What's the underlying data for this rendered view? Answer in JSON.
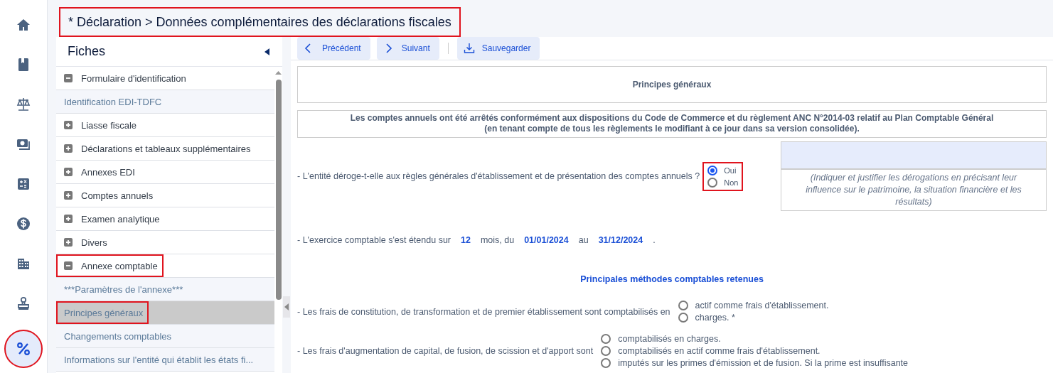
{
  "header": {
    "title": "* Déclaration > Données complémentaires des déclarations fiscales",
    "highlighted": true
  },
  "nav": [
    {
      "kind": "home",
      "selected": false,
      "highlighted": false
    },
    {
      "kind": "book",
      "selected": false,
      "highlighted": false
    },
    {
      "kind": "scale",
      "selected": false,
      "highlighted": false
    },
    {
      "kind": "money",
      "selected": false,
      "highlighted": false
    },
    {
      "kind": "calculator",
      "selected": false,
      "highlighted": false
    },
    {
      "kind": "dollar",
      "selected": false,
      "highlighted": false
    },
    {
      "kind": "building",
      "selected": false,
      "highlighted": false
    },
    {
      "kind": "stamp",
      "selected": false,
      "highlighted": false
    },
    {
      "kind": "percent",
      "selected": true,
      "highlighted": true
    }
  ],
  "sidebar": {
    "title": "Fiches",
    "items": [
      {
        "label": "Formulaire d'identification",
        "expanded": true,
        "highlighted": false,
        "children": [
          {
            "label": "Identification EDI-TDFC",
            "selected": false,
            "highlighted": false
          }
        ]
      },
      {
        "label": "Liasse fiscale",
        "expanded": false,
        "highlighted": false
      },
      {
        "label": "Déclarations et tableaux supplémentaires",
        "expanded": false,
        "highlighted": false
      },
      {
        "label": "Annexes EDI",
        "expanded": false,
        "highlighted": false
      },
      {
        "label": "Comptes annuels",
        "expanded": false,
        "highlighted": false
      },
      {
        "label": "Examen analytique",
        "expanded": false,
        "highlighted": false
      },
      {
        "label": "Divers",
        "expanded": false,
        "highlighted": false
      },
      {
        "label": "Annexe comptable",
        "expanded": true,
        "highlighted": true,
        "children": [
          {
            "label": "***Paramètres de l'annexe***",
            "selected": false,
            "highlighted": false
          },
          {
            "label": "Principes généraux",
            "selected": true,
            "highlighted": true
          },
          {
            "label": "Changements comptables",
            "selected": false,
            "highlighted": false
          },
          {
            "label": "Informations sur l'entité qui établit les états fi...",
            "selected": false,
            "highlighted": false
          }
        ]
      }
    ]
  },
  "toolbar": [
    {
      "kind": "previous",
      "label": "Précédent"
    },
    {
      "kind": "next",
      "label": "Suivant"
    },
    {
      "kind": "save",
      "label": "Sauvegarder"
    }
  ],
  "form": {
    "title": "Principes généraux",
    "intro": [
      "Les comptes annuels ont été arrêtés conformément aux dispositions du Code de Commerce et du règlement ANC N°2014-03 relatif au Plan Comptable Général",
      "(en tenant compte de tous les règlements le modifiant à ce jour dans sa version consolidée)."
    ],
    "blocks": [
      {
        "kind": "question",
        "text": "- L'entité déroge-t-elle aux règles générales d'établissement et de présentation des comptes annuels ?",
        "highlighted": true,
        "options": [
          {
            "label": "Oui",
            "selected": true
          },
          {
            "label": "Non",
            "selected": false
          }
        ],
        "field": {
          "hint": "(Indiquer et justifier les dérogations en précisant leur influence sur le patrimoine, la situation financière et les résultats)"
        }
      },
      {
        "kind": "period",
        "parts": [
          {
            "kind": "text",
            "text": "- L'exercice comptable s'est étendu sur"
          },
          {
            "kind": "value",
            "text": "12"
          },
          {
            "kind": "text",
            "text": "mois, du"
          },
          {
            "kind": "value",
            "text": "01/01/2024"
          },
          {
            "kind": "text",
            "text": "au"
          },
          {
            "kind": "value",
            "text": "31/12/2024"
          },
          {
            "kind": "text",
            "text": "."
          }
        ]
      },
      {
        "kind": "heading",
        "text": "Principales méthodes comptables retenues"
      },
      {
        "kind": "question",
        "text": "- Les frais de constitution, de transformation et de premier établissement sont comptabilisés en",
        "highlighted": false,
        "options": [
          {
            "label": "actif comme frais d'établissement.",
            "selected": false
          },
          {
            "label": "charges. *",
            "selected": false
          }
        ]
      },
      {
        "kind": "question",
        "text": "- Les frais d'augmentation de capital, de fusion, de scission et d'apport sont",
        "highlighted": false,
        "options": [
          {
            "label": "comptabilisés en charges.",
            "selected": false
          },
          {
            "label": "comptabilisés en actif comme frais d'établissement.",
            "selected": false
          },
          {
            "label": "imputés sur les primes d'émission et de fusion. Si la prime est insuffisante",
            "selected": false
          }
        ]
      }
    ]
  }
}
